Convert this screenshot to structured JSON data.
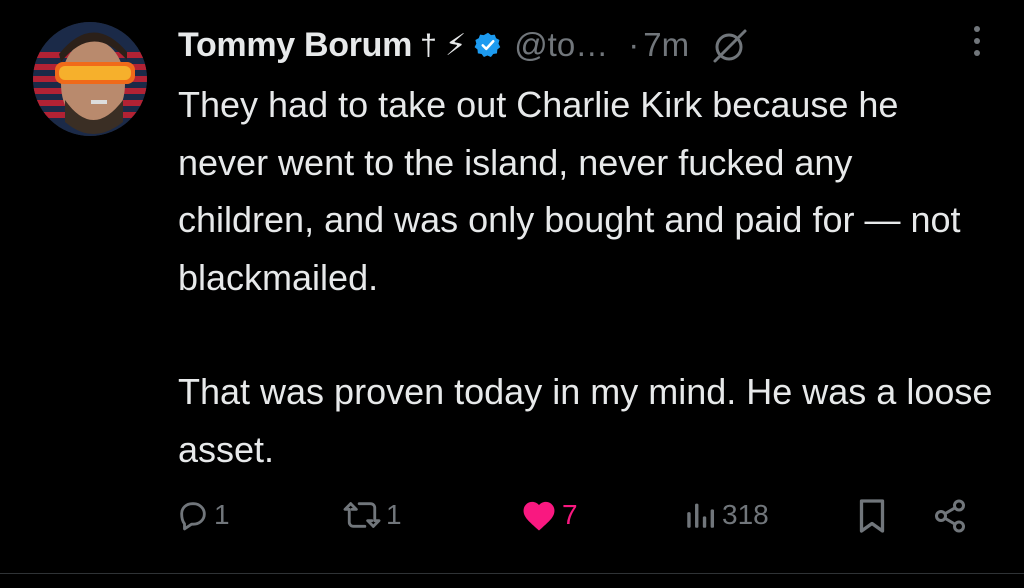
{
  "author": {
    "name": "Tommy Borum",
    "name_glyphs": "† ⚡",
    "handle": "@to…",
    "separator": "·",
    "time": "7m",
    "avatar_icon": "avatar-sunglasses-flag"
  },
  "post": {
    "paragraph1": "They had to take out Charlie Kirk because he never went to the island, never fucked any children, and was only bought and paid for — not blackmailed.",
    "paragraph2": "That was proven today in my mind. He was a loose asset."
  },
  "actions": {
    "replies": "1",
    "reposts": "1",
    "likes": "7",
    "views": "318"
  },
  "colors": {
    "background": "#000000",
    "text": "#e7e9ea",
    "muted": "#71767b",
    "verified": "#1d9bf0",
    "like": "#f91880"
  }
}
